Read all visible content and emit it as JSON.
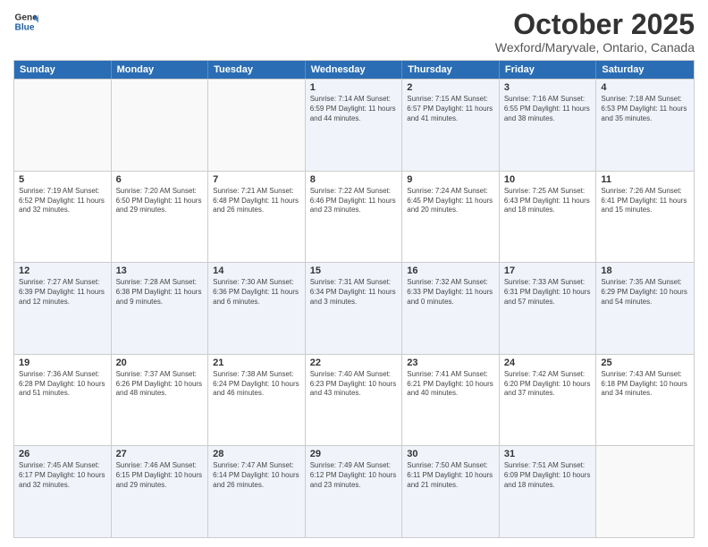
{
  "logo": {
    "line1": "General",
    "line2": "Blue"
  },
  "header": {
    "month": "October 2025",
    "location": "Wexford/Maryvale, Ontario, Canada"
  },
  "days": [
    "Sunday",
    "Monday",
    "Tuesday",
    "Wednesday",
    "Thursday",
    "Friday",
    "Saturday"
  ],
  "rows": [
    [
      {
        "day": "",
        "info": ""
      },
      {
        "day": "",
        "info": ""
      },
      {
        "day": "",
        "info": ""
      },
      {
        "day": "1",
        "info": "Sunrise: 7:14 AM\nSunset: 6:59 PM\nDaylight: 11 hours\nand 44 minutes."
      },
      {
        "day": "2",
        "info": "Sunrise: 7:15 AM\nSunset: 6:57 PM\nDaylight: 11 hours\nand 41 minutes."
      },
      {
        "day": "3",
        "info": "Sunrise: 7:16 AM\nSunset: 6:55 PM\nDaylight: 11 hours\nand 38 minutes."
      },
      {
        "day": "4",
        "info": "Sunrise: 7:18 AM\nSunset: 6:53 PM\nDaylight: 11 hours\nand 35 minutes."
      }
    ],
    [
      {
        "day": "5",
        "info": "Sunrise: 7:19 AM\nSunset: 6:52 PM\nDaylight: 11 hours\nand 32 minutes."
      },
      {
        "day": "6",
        "info": "Sunrise: 7:20 AM\nSunset: 6:50 PM\nDaylight: 11 hours\nand 29 minutes."
      },
      {
        "day": "7",
        "info": "Sunrise: 7:21 AM\nSunset: 6:48 PM\nDaylight: 11 hours\nand 26 minutes."
      },
      {
        "day": "8",
        "info": "Sunrise: 7:22 AM\nSunset: 6:46 PM\nDaylight: 11 hours\nand 23 minutes."
      },
      {
        "day": "9",
        "info": "Sunrise: 7:24 AM\nSunset: 6:45 PM\nDaylight: 11 hours\nand 20 minutes."
      },
      {
        "day": "10",
        "info": "Sunrise: 7:25 AM\nSunset: 6:43 PM\nDaylight: 11 hours\nand 18 minutes."
      },
      {
        "day": "11",
        "info": "Sunrise: 7:26 AM\nSunset: 6:41 PM\nDaylight: 11 hours\nand 15 minutes."
      }
    ],
    [
      {
        "day": "12",
        "info": "Sunrise: 7:27 AM\nSunset: 6:39 PM\nDaylight: 11 hours\nand 12 minutes."
      },
      {
        "day": "13",
        "info": "Sunrise: 7:28 AM\nSunset: 6:38 PM\nDaylight: 11 hours\nand 9 minutes."
      },
      {
        "day": "14",
        "info": "Sunrise: 7:30 AM\nSunset: 6:36 PM\nDaylight: 11 hours\nand 6 minutes."
      },
      {
        "day": "15",
        "info": "Sunrise: 7:31 AM\nSunset: 6:34 PM\nDaylight: 11 hours\nand 3 minutes."
      },
      {
        "day": "16",
        "info": "Sunrise: 7:32 AM\nSunset: 6:33 PM\nDaylight: 11 hours\nand 0 minutes."
      },
      {
        "day": "17",
        "info": "Sunrise: 7:33 AM\nSunset: 6:31 PM\nDaylight: 10 hours\nand 57 minutes."
      },
      {
        "day": "18",
        "info": "Sunrise: 7:35 AM\nSunset: 6:29 PM\nDaylight: 10 hours\nand 54 minutes."
      }
    ],
    [
      {
        "day": "19",
        "info": "Sunrise: 7:36 AM\nSunset: 6:28 PM\nDaylight: 10 hours\nand 51 minutes."
      },
      {
        "day": "20",
        "info": "Sunrise: 7:37 AM\nSunset: 6:26 PM\nDaylight: 10 hours\nand 48 minutes."
      },
      {
        "day": "21",
        "info": "Sunrise: 7:38 AM\nSunset: 6:24 PM\nDaylight: 10 hours\nand 46 minutes."
      },
      {
        "day": "22",
        "info": "Sunrise: 7:40 AM\nSunset: 6:23 PM\nDaylight: 10 hours\nand 43 minutes."
      },
      {
        "day": "23",
        "info": "Sunrise: 7:41 AM\nSunset: 6:21 PM\nDaylight: 10 hours\nand 40 minutes."
      },
      {
        "day": "24",
        "info": "Sunrise: 7:42 AM\nSunset: 6:20 PM\nDaylight: 10 hours\nand 37 minutes."
      },
      {
        "day": "25",
        "info": "Sunrise: 7:43 AM\nSunset: 6:18 PM\nDaylight: 10 hours\nand 34 minutes."
      }
    ],
    [
      {
        "day": "26",
        "info": "Sunrise: 7:45 AM\nSunset: 6:17 PM\nDaylight: 10 hours\nand 32 minutes."
      },
      {
        "day": "27",
        "info": "Sunrise: 7:46 AM\nSunset: 6:15 PM\nDaylight: 10 hours\nand 29 minutes."
      },
      {
        "day": "28",
        "info": "Sunrise: 7:47 AM\nSunset: 6:14 PM\nDaylight: 10 hours\nand 26 minutes."
      },
      {
        "day": "29",
        "info": "Sunrise: 7:49 AM\nSunset: 6:12 PM\nDaylight: 10 hours\nand 23 minutes."
      },
      {
        "day": "30",
        "info": "Sunrise: 7:50 AM\nSunset: 6:11 PM\nDaylight: 10 hours\nand 21 minutes."
      },
      {
        "day": "31",
        "info": "Sunrise: 7:51 AM\nSunset: 6:09 PM\nDaylight: 10 hours\nand 18 minutes."
      },
      {
        "day": "",
        "info": ""
      }
    ]
  ]
}
